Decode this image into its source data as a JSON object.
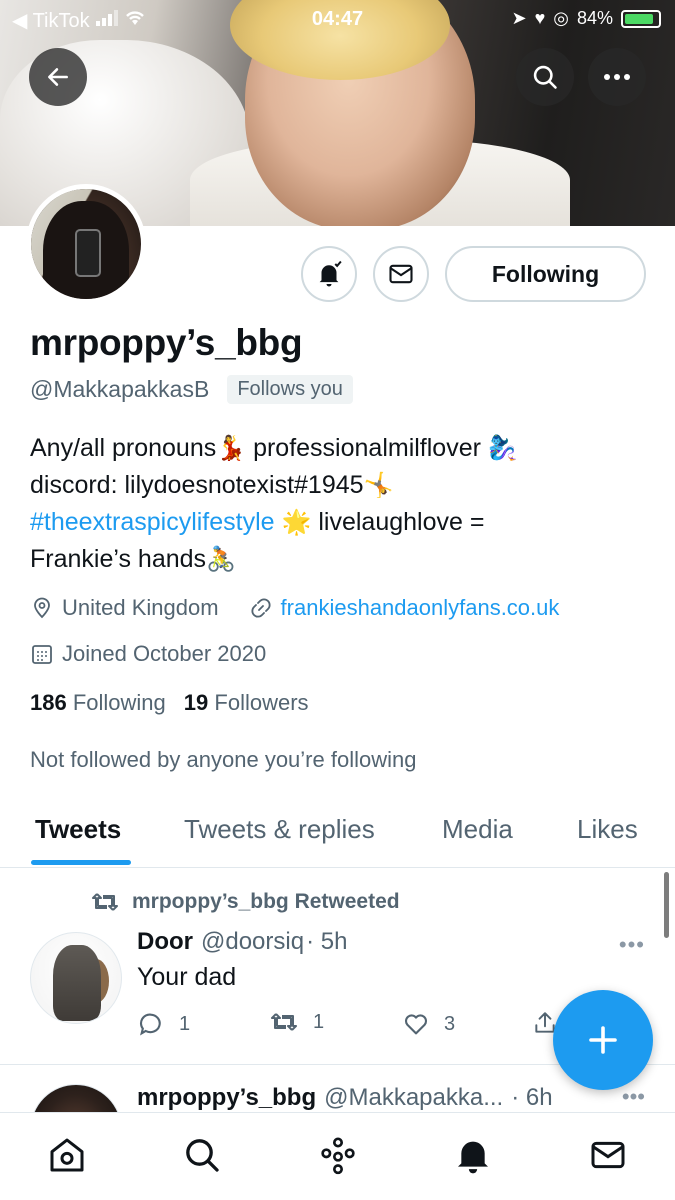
{
  "status_bar": {
    "back_app": "◀ TikTok",
    "time": "04:47",
    "battery": "84%"
  },
  "header": {
    "back_icon": "arrow-left-icon",
    "search_icon": "search-icon",
    "more_icon": "more-horizontal-icon"
  },
  "profile": {
    "name": "mrpoppy’s_bbg",
    "handle": "@MakkapakkasB",
    "follows_you": "Follows you",
    "bio_line1": "Any/all pronouns",
    "bio_line1_emoji1": "💃",
    "bio_line1_b": " professionalmilflover",
    "bio_line1_emoji2": "🧞‍♀️",
    "bio_line2": "discord: lilydoesnotexist#1945",
    "bio_line2_emoji": "🤸",
    "bio_hashtag": "#theextraspicylifestyle",
    "bio_line3_emoji": "🌟",
    "bio_line3_b": " livelaughlove =",
    "bio_line4": "Frankie’s hands",
    "bio_line4_emoji": "🚴",
    "location": "United Kingdom",
    "website": "frankieshandaonlyfans.co.uk",
    "joined": "Joined October 2020",
    "following_count": "186",
    "following_label": "Following",
    "followers_count": "19",
    "followers_label": "Followers",
    "not_followed": "Not followed by anyone you’re following",
    "follow_button": "Following"
  },
  "tabs": [
    {
      "label": "Tweets",
      "active": true
    },
    {
      "label": "Tweets & replies",
      "active": false
    },
    {
      "label": "Media",
      "active": false
    },
    {
      "label": "Likes",
      "active": false
    }
  ],
  "tweets": [
    {
      "retweeted_by": "mrpoppy’s_bbg Retweeted",
      "name": "Door",
      "handle": "@doorsiq",
      "time": "· 5h",
      "text": "Your dad",
      "replies": "1",
      "retweets": "1",
      "likes": "3"
    },
    {
      "name": "mrpoppy’s_bbg",
      "handle": "@Makkapakka...",
      "time": "· 6h"
    }
  ],
  "colors": {
    "accent": "#1d9bf0",
    "text": "#0f1419",
    "secondary": "#536471",
    "border": "#cfd9de"
  }
}
